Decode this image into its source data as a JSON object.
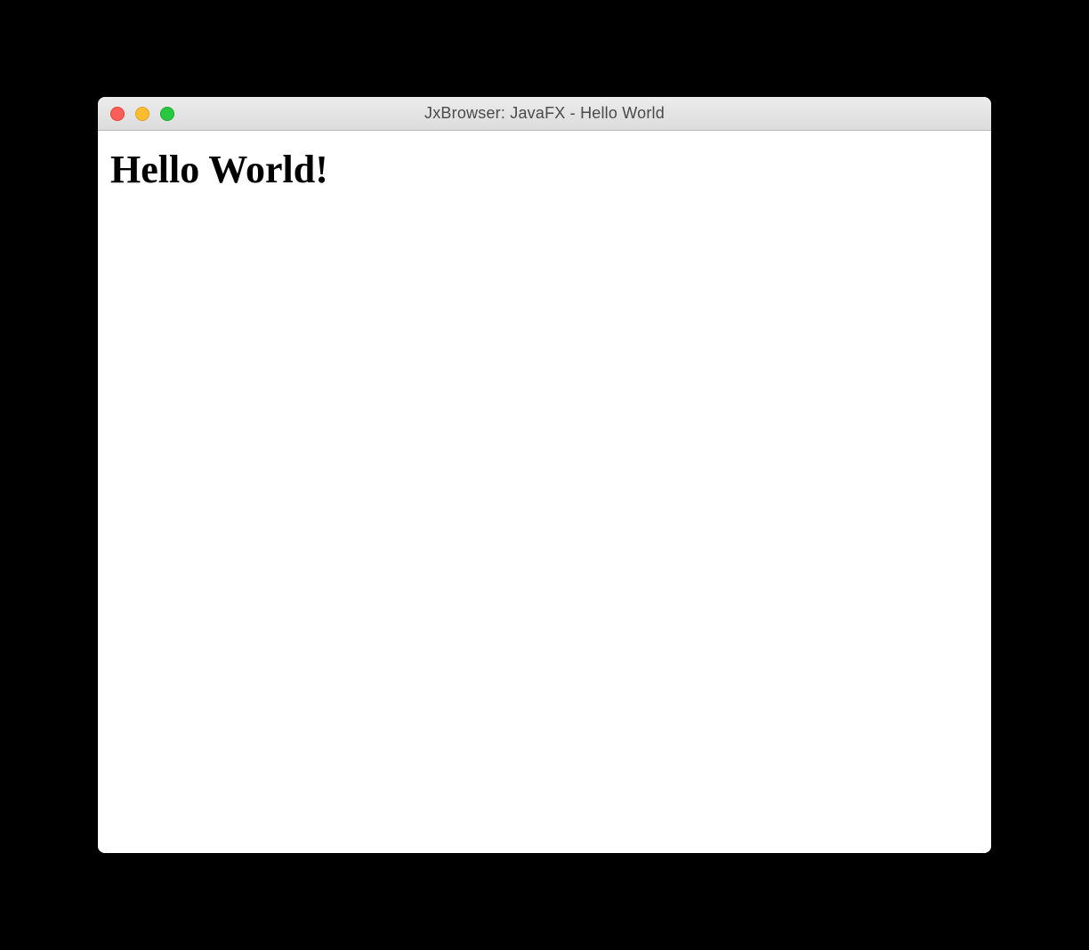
{
  "window": {
    "title": "JxBrowser: JavaFX - Hello World"
  },
  "content": {
    "heading": "Hello World!"
  }
}
